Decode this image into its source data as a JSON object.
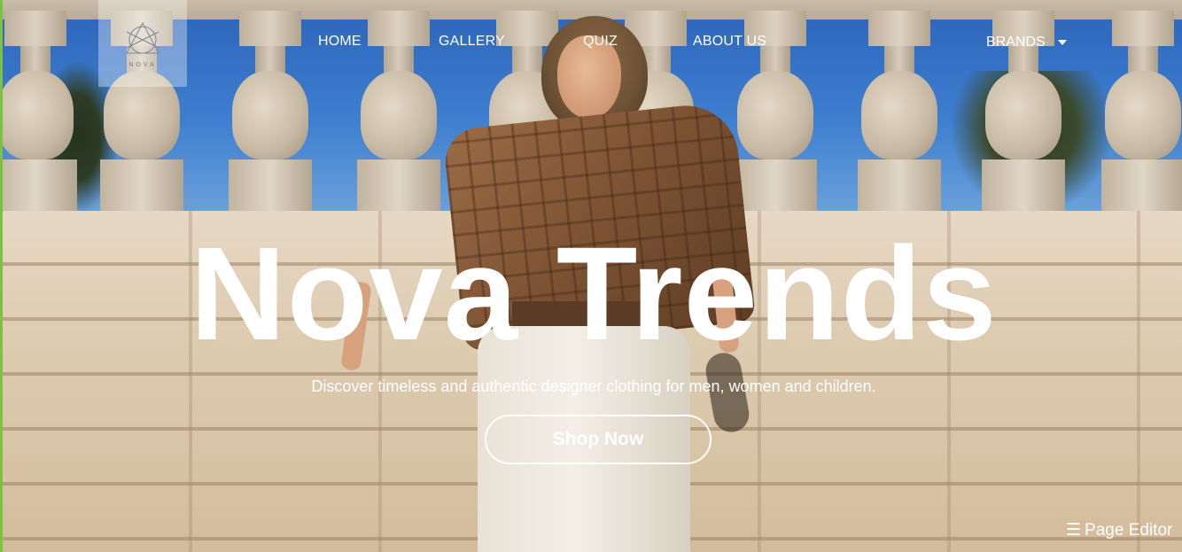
{
  "logo": {
    "text": "NOVA",
    "icon": "nova-geometric-logo"
  },
  "nav": {
    "home": "HOME",
    "gallery": "GALLERY",
    "quiz": "QUIZ",
    "about": "ABOUT US",
    "brands": "BRANDS",
    "brands_icon": "caret-down-icon"
  },
  "hero": {
    "title": "Nova Trends",
    "subtitle": "Discover timeless and authentic designer clothing for men, women and children.",
    "cta_label": "Shop Now"
  },
  "page_editor": {
    "icon": "☰",
    "label": "Page Editor"
  },
  "colors": {
    "text": "#ffffff",
    "accent_edge": "#7cc242"
  }
}
